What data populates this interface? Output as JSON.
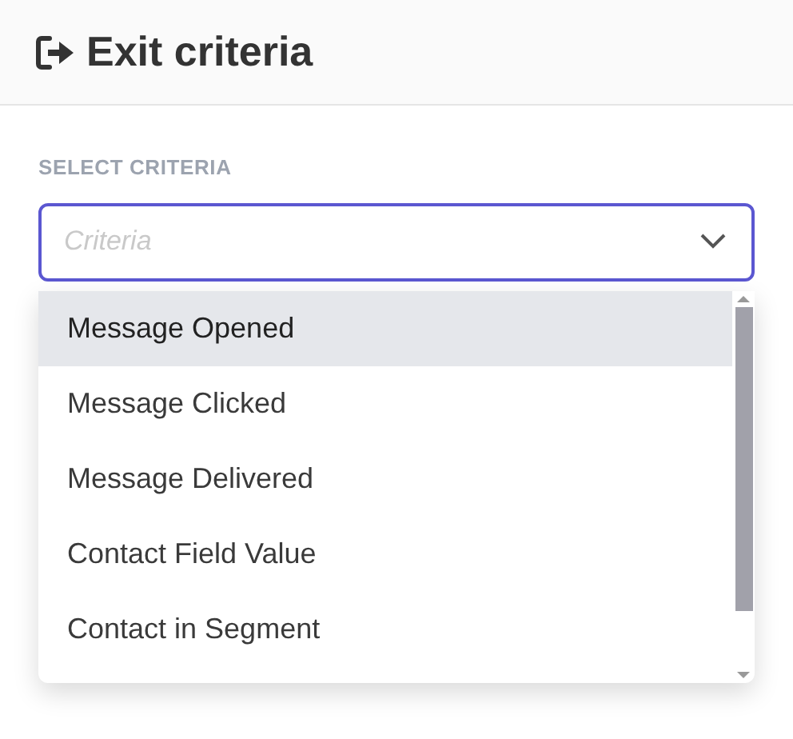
{
  "header": {
    "title": "Exit criteria"
  },
  "field": {
    "label": "SELECT CRITERIA",
    "placeholder": "Criteria",
    "expanded": true
  },
  "options": [
    {
      "label": "Message Opened",
      "selected": true
    },
    {
      "label": "Message Clicked",
      "selected": false
    },
    {
      "label": "Message Delivered",
      "selected": false
    },
    {
      "label": "Contact Field Value",
      "selected": false
    },
    {
      "label": "Contact in Segment",
      "selected": false
    }
  ]
}
